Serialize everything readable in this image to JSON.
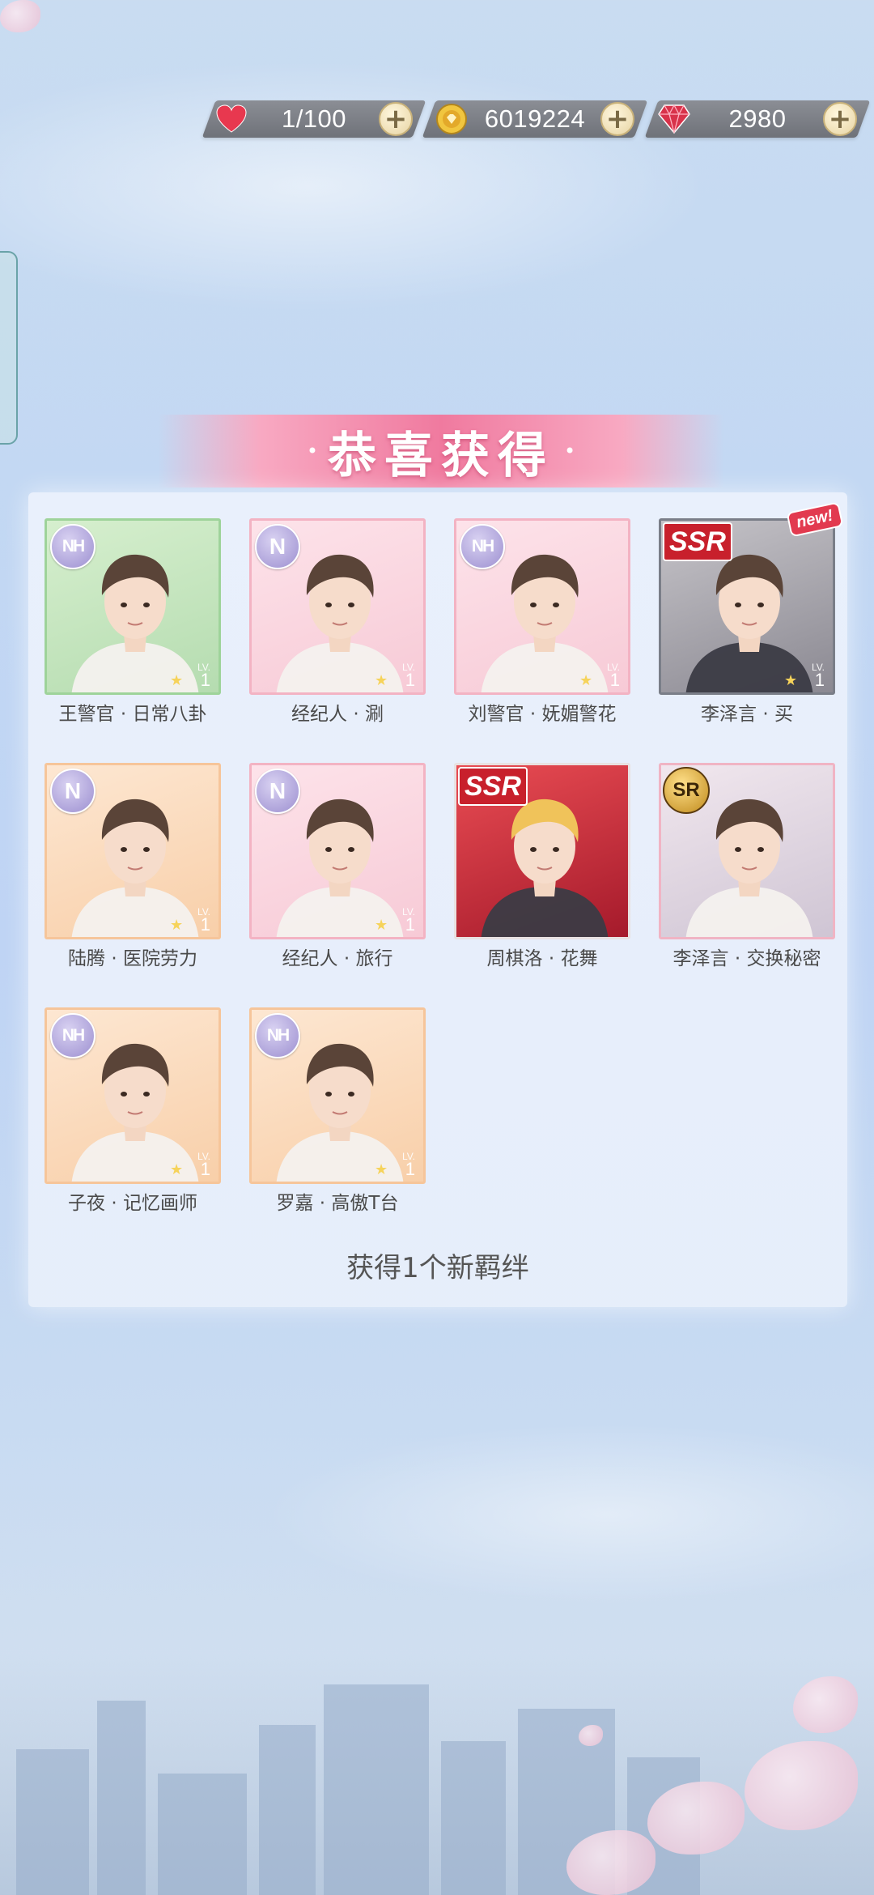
{
  "resources": {
    "stamina": {
      "value": "1/100",
      "icon": "heart-icon",
      "color": "#e8384f"
    },
    "gold": {
      "value": "6019224",
      "icon": "gold-coin-icon",
      "color": "#e7b436"
    },
    "diamond": {
      "value": "2980",
      "icon": "diamond-icon",
      "color": "#d8324a"
    }
  },
  "banner": {
    "title": "恭喜获得"
  },
  "cards": [
    {
      "name": "王警官 · 日常八卦",
      "rarity": "NH",
      "level_label": "LV.",
      "level": "1",
      "frame": "green"
    },
    {
      "name": "经纪人 · 涮",
      "rarity": "N",
      "level_label": "LV.",
      "level": "1",
      "frame": "pink"
    },
    {
      "name": "刘警官 · 妩媚警花",
      "rarity": "NH",
      "level_label": "LV.",
      "level": "1",
      "frame": "pink"
    },
    {
      "name": "李泽言 · 买",
      "rarity": "SSR",
      "level_label": "LV.",
      "level": "1",
      "frame": "dark",
      "new": "new!"
    },
    {
      "name": "陆腾 · 医院劳力",
      "rarity": "N",
      "level_label": "LV.",
      "level": "1",
      "frame": "orange"
    },
    {
      "name": "经纪人 · 旅行",
      "rarity": "N",
      "level_label": "LV.",
      "level": "1",
      "frame": "pink"
    },
    {
      "name": "周棋洛 · 花舞",
      "rarity": "SSR",
      "level_label": "",
      "level": "",
      "frame": "ssr"
    },
    {
      "name": "李泽言 · 交换秘密",
      "rarity": "SR",
      "level_label": "",
      "level": "",
      "frame": "sr"
    },
    {
      "name": "子夜 · 记忆画师",
      "rarity": "NH",
      "level_label": "LV.",
      "level": "1",
      "frame": "orange"
    },
    {
      "name": "罗嘉 · 高傲T台",
      "rarity": "NH",
      "level_label": "LV.",
      "level": "1",
      "frame": "orange"
    }
  ],
  "footer": {
    "text": "获得1个新羁绊"
  }
}
